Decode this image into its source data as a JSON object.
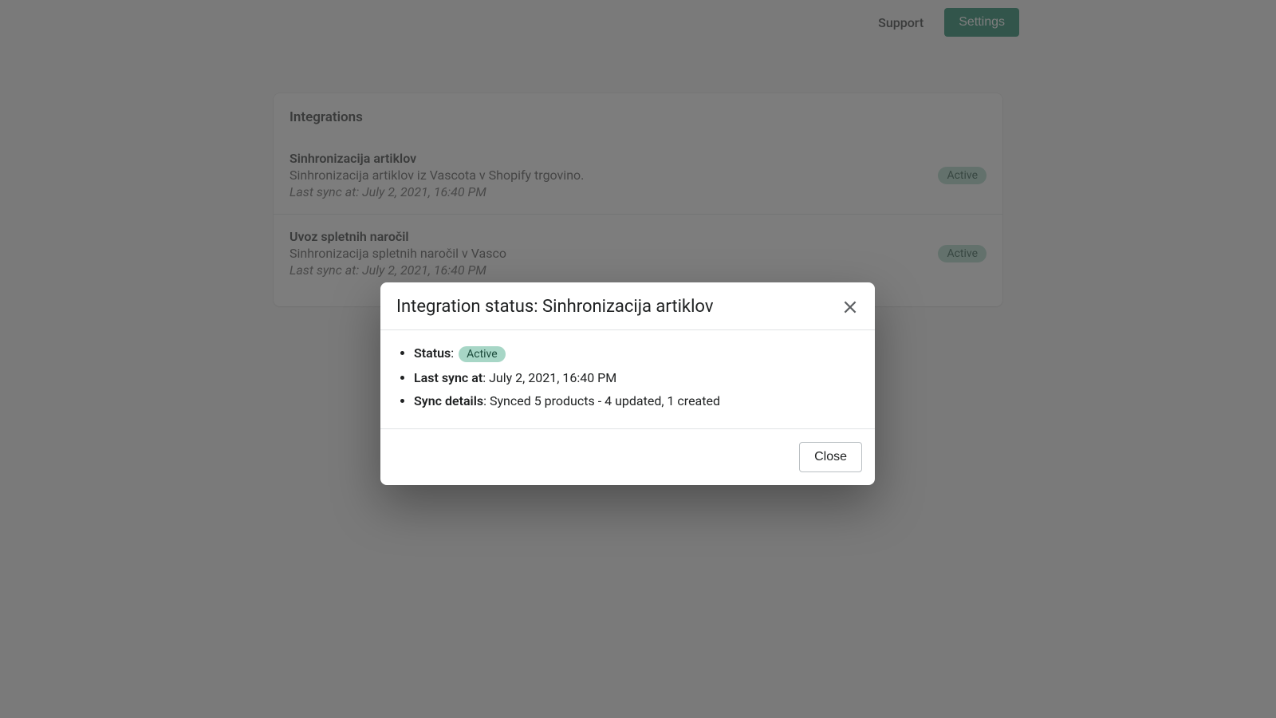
{
  "nav": {
    "support": "Support",
    "settings": "Settings"
  },
  "card": {
    "title": "Integrations",
    "rows": [
      {
        "name": "Sinhronizacija artiklov",
        "desc": "Sinhronizacija artiklov iz Vascota v Shopify trgovino.",
        "sync_prefix": "Last sync at: ",
        "sync_time": "July 2, 2021, 16:40 PM",
        "badge": "Active"
      },
      {
        "name": "Uvoz spletnih naročil",
        "desc": "Sinhronizacija spletnih naročil v Vasco",
        "sync_prefix": "Last sync at: ",
        "sync_time": "July 2, 2021, 16:40 PM",
        "badge": "Active"
      }
    ]
  },
  "modal": {
    "title": "Integration status: Sinhronizacija artiklov",
    "status_label": "Status",
    "status_value": "Active",
    "last_sync_label": "Last sync at",
    "last_sync_value": "July 2, 2021, 16:40 PM",
    "details_label": "Sync details",
    "details_value": "Synced 5 products - 4 updated, 1 created",
    "close": "Close"
  }
}
